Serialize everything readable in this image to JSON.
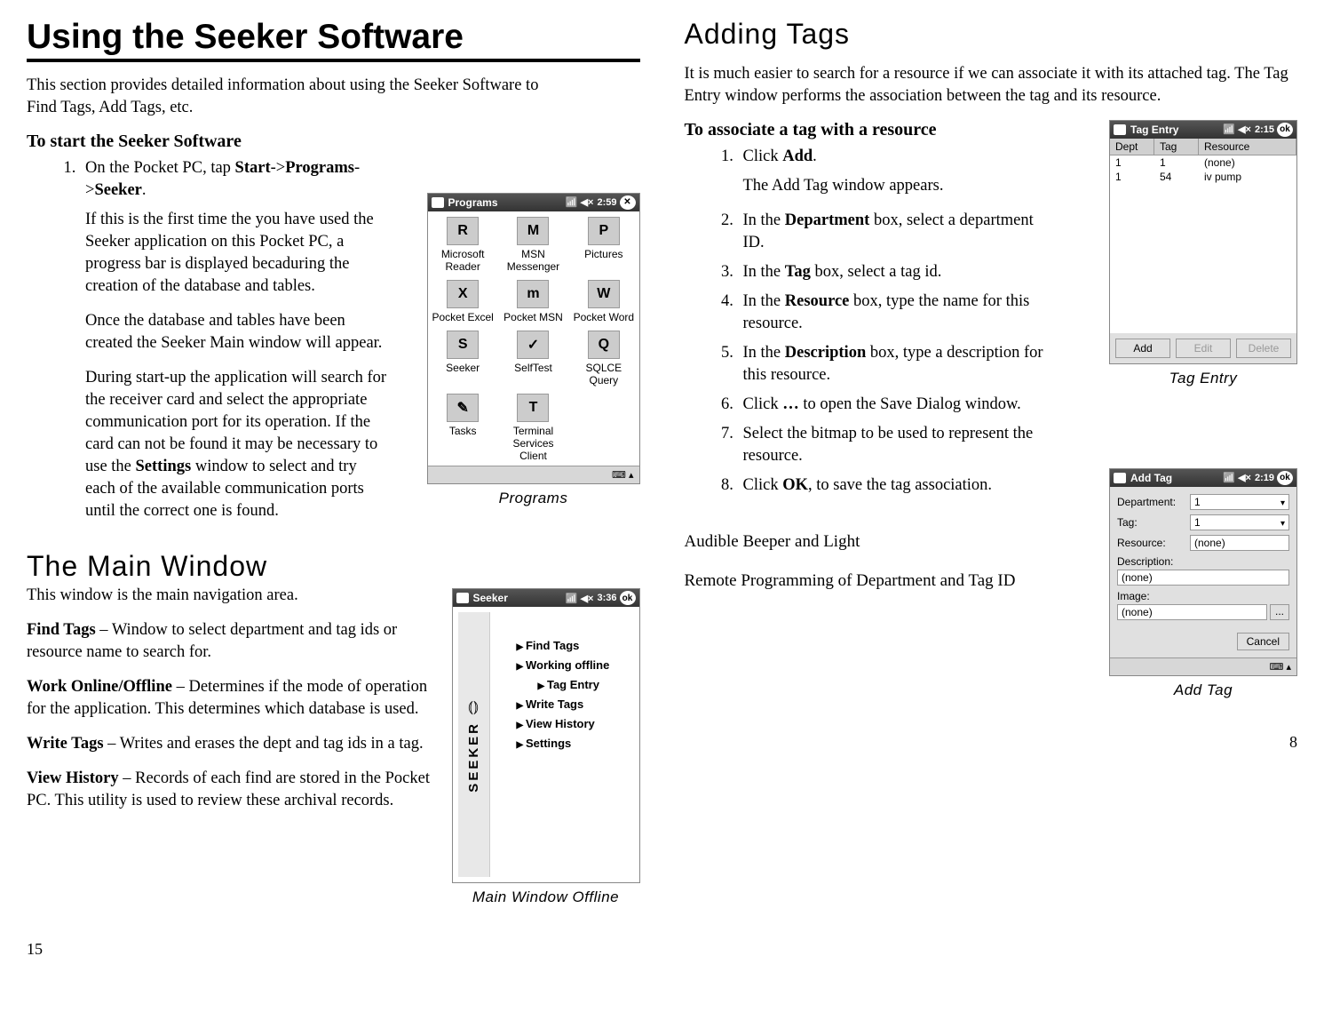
{
  "left": {
    "title": "Using the Seeker Software",
    "intro": "This section provides detailed information about using the Seeker Software to Find Tags, Add Tags, etc.",
    "start_heading": "To start the Seeker Software",
    "step1_pre": "On the Pocket PC, tap ",
    "step1_b1": "Start",
    "step1_mid1": "->",
    "step1_b2": "Programs",
    "step1_mid2": "->",
    "step1_b3": "Seeker",
    "step1_post": ".",
    "para1": "If this is the first time the you have used the Seeker application on this Pocket PC,  a  progress bar is displayed becaduring the creation of the database and tables.",
    "para2": "Once the database and tables have been created the Seeker Main window will appear.",
    "para3a": "During start-up the application will search for the receiver card and select the appropriate communication port for its operation.  If the card can not be found it may be necessary to use the ",
    "para3b": "Settings",
    "para3c": " window to select and try each of the available communication ports until the correct one is found.",
    "fig_programs_caption": "Programs",
    "programs": {
      "titlebar": "Programs",
      "time": "2:59",
      "icons": [
        {
          "label": "Microsoft Reader",
          "g": "R"
        },
        {
          "label": "MSN Messenger",
          "g": "M"
        },
        {
          "label": "Pictures",
          "g": "P"
        },
        {
          "label": "Pocket Excel",
          "g": "X"
        },
        {
          "label": "Pocket MSN",
          "g": "m"
        },
        {
          "label": "Pocket Word",
          "g": "W"
        },
        {
          "label": "Seeker",
          "g": "S"
        },
        {
          "label": "SelfTest",
          "g": "✓"
        },
        {
          "label": "SQLCE Query",
          "g": "Q"
        },
        {
          "label": "Tasks",
          "g": "✎"
        },
        {
          "label": "Terminal Services Client",
          "g": "T"
        }
      ]
    },
    "main_section_title": "The Main Window",
    "main_intro": "This window is the main navigation area.",
    "desc": {
      "find_label": "Find Tags",
      "find_text": " – Window to select department and tag ids or resource name to search for.",
      "work_label": "Work Online/Offline",
      "work_text": " – Determines if the mode of operation for the application. This determines which database is used.",
      "write_label": "Write Tags",
      "write_text": " – Writes and erases the dept and tag ids in a tag.",
      "view_label": "View History",
      "view_text": " – Records of each find are stored in the Pocket PC.  This utility is used to review these archival records."
    },
    "seeker_fig_caption": "Main Window Offline",
    "seeker": {
      "titlebar": "Seeker",
      "time": "3:36",
      "ok": "ok",
      "logo": "SEEKER",
      "items": [
        "Find Tags",
        "Working offline",
        "Tag Entry",
        "Write Tags",
        "View History",
        "Settings"
      ]
    },
    "page_num": "15"
  },
  "right": {
    "title": "Adding Tags",
    "intro": "It is much easier to search for a resource if we can associate it with its attached tag.  The Tag Entry window performs the association between the tag and its resource.",
    "assoc_heading": "To associate a tag with a resource",
    "steps": [
      {
        "pre": "Click ",
        "b": "Add",
        "post": ".",
        "after": "The Add Tag window appears."
      },
      {
        "pre": "In the ",
        "b": "Department",
        "post": " box, select a department ID."
      },
      {
        "pre": "In the ",
        "b": "Tag",
        "post": " box, select a tag id."
      },
      {
        "pre": "In the ",
        "b": "Resource",
        "post": " box, type the name for this resource."
      },
      {
        "pre": "In the ",
        "b": "Description",
        "post": " box, type a description for this resource."
      },
      {
        "pre": "Click ",
        "b": "…",
        "post": " to open the Save Dialog window."
      },
      {
        "plain": "Select the bitmap to be used to represent the resource."
      },
      {
        "pre": "Click ",
        "b": "OK",
        "post": ", to save the tag association."
      }
    ],
    "tag_entry_caption": "Tag Entry",
    "tag_entry": {
      "titlebar": "Tag Entry",
      "time": "2:15",
      "ok": "ok",
      "cols": [
        "Dept",
        "Tag",
        "Resource"
      ],
      "rows": [
        {
          "dept": "1",
          "tag": "1",
          "res": "(none)"
        },
        {
          "dept": "1",
          "tag": "54",
          "res": "iv pump"
        }
      ],
      "buttons": {
        "add": "Add",
        "edit": "Edit",
        "delete": "Delete"
      }
    },
    "audible": "Audible Beeper and Light",
    "remote": "Remote Programming of Department and Tag ID",
    "add_tag_caption": "Add Tag",
    "add_tag": {
      "titlebar": "Add Tag",
      "time": "2:19",
      "ok": "ok",
      "fields": {
        "department_label": "Department:",
        "department_val": "1",
        "tag_label": "Tag:",
        "tag_val": "1",
        "resource_label": "Resource:",
        "resource_val": "(none)",
        "description_label": "Description:",
        "description_val": "(none)",
        "image_label": "Image:",
        "image_val": "(none)"
      },
      "browse": "...",
      "cancel": "Cancel"
    },
    "page_num": "8"
  }
}
